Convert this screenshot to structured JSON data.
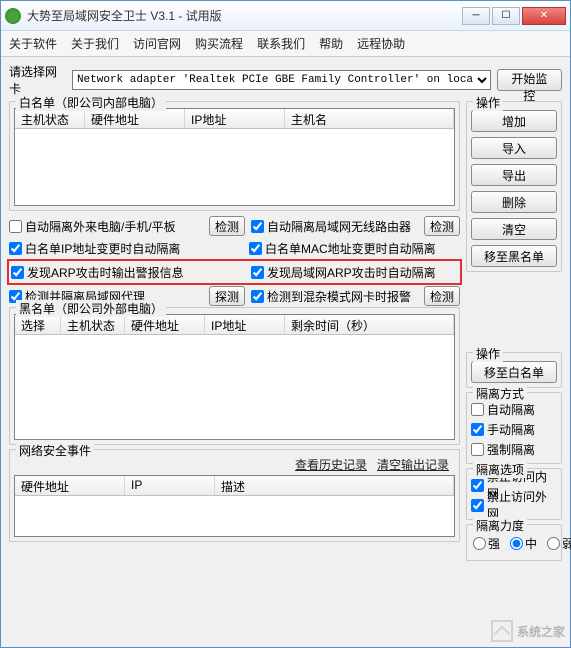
{
  "window": {
    "title": "大势至局域网安全卫士 V3.1 - 试用版"
  },
  "menu": [
    "关于软件",
    "关于我们",
    "访问官网",
    "购买流程",
    "联系我们",
    "帮助",
    "远程协助"
  ],
  "adapter": {
    "label": "请选择网卡",
    "value": "Network adapter 'Realtek PCIe GBE Family Controller' on loca"
  },
  "buttons": {
    "start_monitor": "开始监控",
    "add": "增加",
    "import": "导入",
    "export": "导出",
    "delete": "删除",
    "clear": "清空",
    "move_black": "移至黑名单",
    "move_white": "移至白名单",
    "detect": "检测",
    "probe": "探测"
  },
  "whitelist": {
    "title": "白名单（即公司内部电脑）",
    "columns": [
      "主机状态",
      "硬件地址",
      "IP地址",
      "主机名"
    ]
  },
  "checks": {
    "c1": {
      "label": "自动隔离外来电脑/手机/平板",
      "checked": false
    },
    "c2": {
      "label": "自动隔离局域网无线路由器",
      "checked": true
    },
    "c3": {
      "label": "白名单IP地址变更时自动隔离",
      "checked": true
    },
    "c4": {
      "label": "白名单MAC地址变更时自动隔离",
      "checked": true
    },
    "c5": {
      "label": "发现ARP攻击时输出警报信息",
      "checked": true
    },
    "c6": {
      "label": "发现局域网ARP攻击时自动隔离",
      "checked": true
    },
    "c7": {
      "label": "检测并隔离局域网代理",
      "checked": true
    },
    "c8": {
      "label": "检测到混杂模式网卡时报警",
      "checked": true
    }
  },
  "blacklist": {
    "title": "黑名单（即公司外部电脑）",
    "columns": [
      "选择",
      "主机状态",
      "硬件地址",
      "IP地址",
      "剩余时间（秒）"
    ]
  },
  "ops_title": "操作",
  "iso_mode": {
    "title": "隔离方式",
    "auto": {
      "label": "自动隔离",
      "checked": false
    },
    "manual": {
      "label": "手动隔离",
      "checked": true
    },
    "force": {
      "label": "强制隔离",
      "checked": false
    }
  },
  "iso_opt": {
    "title": "隔离选项",
    "deny_in": {
      "label": "禁止访问内网",
      "checked": true
    },
    "deny_out": {
      "label": "禁止访问外网",
      "checked": true
    }
  },
  "events": {
    "title": "网络安全事件",
    "view_history": "查看历史记录",
    "clear_output": "清空输出记录",
    "columns": [
      "硬件地址",
      "IP",
      "描述"
    ]
  },
  "iso_strength": {
    "title": "隔离力度",
    "strong": "强",
    "mid": "中",
    "weak": "弱",
    "selected": "mid"
  },
  "watermark": "系统之家"
}
